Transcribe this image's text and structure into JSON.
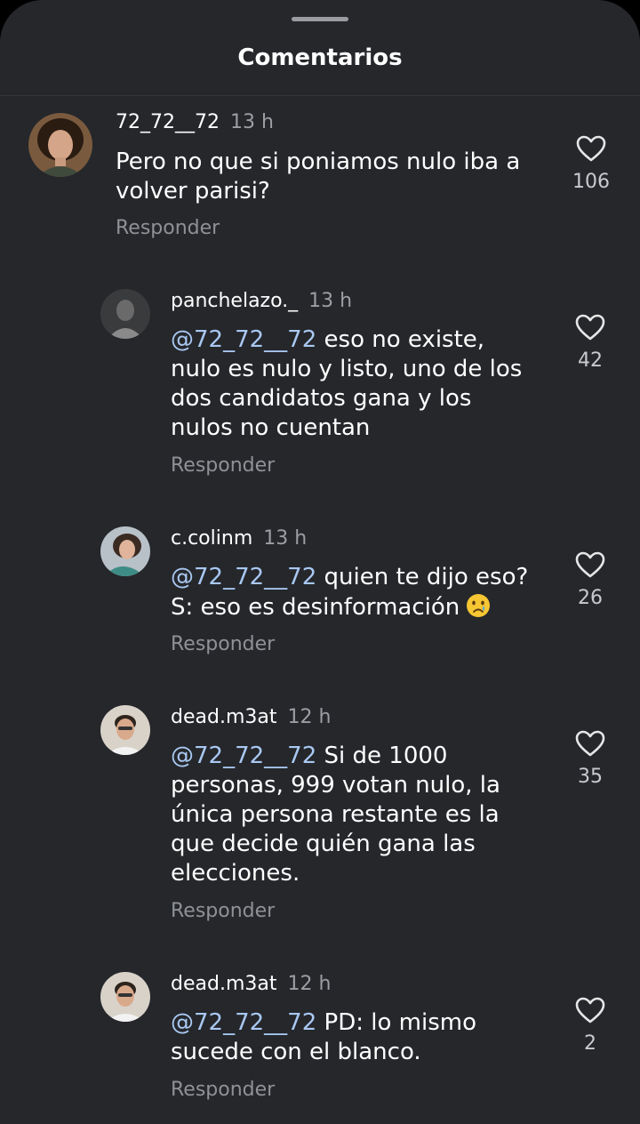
{
  "sheet": {
    "title": "Comentarios"
  },
  "comments": [
    {
      "username": "72_72__72",
      "time": "13 h",
      "text_lines": [
        "Pero no que si poniamos nulo iba a",
        "volver parisi?"
      ],
      "likes": "106",
      "reply_label": "Responder"
    },
    {
      "username": "panchelazo._",
      "time": "13 h",
      "mention": "@72_72__72",
      "text_first": " eso no existe,",
      "text_lines": [
        "nulo es nulo y listo, uno de los",
        "dos candidatos gana y los",
        "nulos no cuentan"
      ],
      "likes": "42",
      "reply_label": "Responder"
    },
    {
      "username": "c.colinm",
      "time": "13 h",
      "mention": "@72_72__72",
      "text_first": " quien te dijo eso?",
      "text_lines": [
        "S: eso es desinformación"
      ],
      "emoji": "crying-face-emoji",
      "likes": "26",
      "reply_label": "Responder"
    },
    {
      "username": "dead.m3at",
      "time": "12 h",
      "mention": "@72_72__72",
      "text_first": " Si de 1000",
      "text_lines": [
        "personas, 999 votan nulo, la",
        "única persona restante es la",
        "que decide quién gana las",
        "elecciones."
      ],
      "likes": "35",
      "reply_label": "Responder"
    },
    {
      "username": "dead.m3at",
      "time": "12 h",
      "mention": "@72_72__72",
      "text_first": " PD: lo mismo",
      "text_lines": [
        "sucede con el blanco."
      ],
      "likes": "2",
      "reply_label": "Responder"
    }
  ],
  "icons": {
    "like": "heart-outline-icon",
    "handle": "drag-handle"
  },
  "colors": {
    "background": "#25272b",
    "mention": "#a9c8f2",
    "muted": "#9c9ea3"
  }
}
